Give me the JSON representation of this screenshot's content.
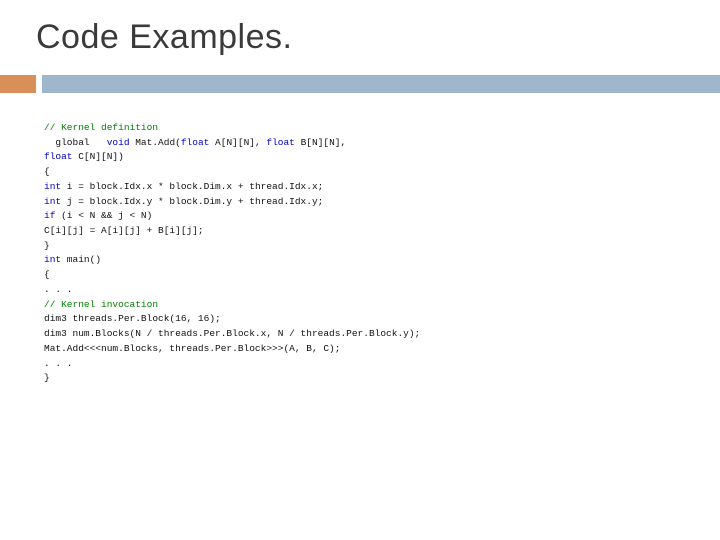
{
  "title": "Code Examples.",
  "code": {
    "l01": "// Kernel definition",
    "l02_a": "  global   ",
    "l02_b": "void",
    "l02_c": " Mat.Add(",
    "l02_d": "float",
    "l02_e": " A[N][N], ",
    "l02_f": "float",
    "l02_g": " B[N][N],",
    "l03_a": "float",
    "l03_b": " C[N][N])",
    "l04": "{",
    "l05_a": "int",
    "l05_b": " i = block.Idx.x * block.Dim.x + thread.Idx.x;",
    "l06_a": "int",
    "l06_b": " j = block.Idx.y * block.Dim.y + thread.Idx.y;",
    "l07_a": "if",
    "l07_b": " (i < N && j < N)",
    "l08": "C[i][j] = A[i][j] + B[i][j];",
    "l09": "}",
    "l10_a": "int",
    "l10_b": " main()",
    "l11": "{",
    "l12": ". . .",
    "l13": "// Kernel invocation",
    "l14": "dim3 threads.Per.Block(16, 16);",
    "l15": "dim3 num.Blocks(N / threads.Per.Block.x, N / threads.Per.Block.y);",
    "l16": "Mat.Add<<<num.Blocks, threads.Per.Block>>>(A, B, C);",
    "l17": ". . .",
    "l18": "}"
  }
}
